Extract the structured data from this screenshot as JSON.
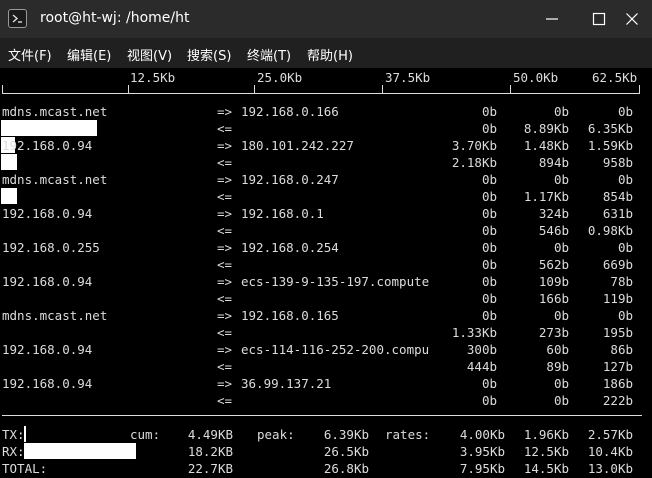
{
  "window": {
    "title": "root@ht-wj: /home/ht"
  },
  "menu": [
    "文件(F)",
    "编辑(E)",
    "视图(V)",
    "搜索(S)",
    "终端(T)",
    "帮助(H)"
  ],
  "scale": [
    "12.5Kb",
    "25.0Kb",
    "37.5Kb",
    "50.0Kb",
    "62.5Kb"
  ],
  "flows": [
    {
      "host": "mdns.mcast.net",
      "out": {
        "dir": "=>",
        "dest": "192.168.0.166",
        "v1": "0b",
        "v2": "0b",
        "v3": "0b"
      },
      "in": {
        "dir": "<=",
        "v1": "0b",
        "v2": "8.89Kb",
        "v3": "6.35Kb"
      }
    },
    {
      "host": "192.168.0.94",
      "out": {
        "dir": "=>",
        "dest": "180.101.242.227",
        "v1": "3.70Kb",
        "v2": "1.48Kb",
        "v3": "1.59Kb"
      },
      "in": {
        "dir": "<=",
        "v1": "2.18Kb",
        "v2": "894b",
        "v3": "958b"
      }
    },
    {
      "host": "mdns.mcast.net",
      "out": {
        "dir": "=>",
        "dest": "192.168.0.247",
        "v1": "0b",
        "v2": "0b",
        "v3": "0b"
      },
      "in": {
        "dir": "<=",
        "v1": "0b",
        "v2": "1.17Kb",
        "v3": "854b"
      }
    },
    {
      "host": "192.168.0.94",
      "out": {
        "dir": "=>",
        "dest": "192.168.0.1",
        "v1": "0b",
        "v2": "324b",
        "v3": "631b"
      },
      "in": {
        "dir": "<=",
        "v1": "0b",
        "v2": "546b",
        "v3": "0.98Kb"
      }
    },
    {
      "host": "192.168.0.255",
      "out": {
        "dir": "=>",
        "dest": "192.168.0.254",
        "v1": "0b",
        "v2": "0b",
        "v3": "0b"
      },
      "in": {
        "dir": "<=",
        "v1": "0b",
        "v2": "562b",
        "v3": "669b"
      }
    },
    {
      "host": "192.168.0.94",
      "out": {
        "dir": "=>",
        "dest": "ecs-139-9-135-197.compute",
        "v1": "0b",
        "v2": "109b",
        "v3": "78b"
      },
      "in": {
        "dir": "<=",
        "v1": "0b",
        "v2": "166b",
        "v3": "119b"
      }
    },
    {
      "host": "mdns.mcast.net",
      "out": {
        "dir": "=>",
        "dest": "192.168.0.165",
        "v1": "0b",
        "v2": "0b",
        "v3": "0b"
      },
      "in": {
        "dir": "<=",
        "v1": "1.33Kb",
        "v2": "273b",
        "v3": "195b"
      }
    },
    {
      "host": "192.168.0.94",
      "out": {
        "dir": "=>",
        "dest": "ecs-114-116-252-200.compu",
        "v1": "300b",
        "v2": "60b",
        "v3": "86b"
      },
      "in": {
        "dir": "<=",
        "v1": "444b",
        "v2": "89b",
        "v3": "127b"
      }
    },
    {
      "host": "192.168.0.94",
      "out": {
        "dir": "=>",
        "dest": "36.99.137.21",
        "v1": "0b",
        "v2": "0b",
        "v3": "186b"
      },
      "in": {
        "dir": "<=",
        "v1": "0b",
        "v2": "0b",
        "v3": "222b"
      }
    }
  ],
  "totals": {
    "labels": {
      "cum": "cum:",
      "peak": "peak:",
      "rates": "rates:"
    },
    "rows": [
      {
        "name": "TX:",
        "cum": "4.49KB",
        "peak": "6.39Kb",
        "r1": "4.00Kb",
        "r2": "1.96Kb",
        "r3": "2.57Kb"
      },
      {
        "name": "RX:",
        "cum": "18.2KB",
        "peak": "26.5Kb",
        "r1": "3.95Kb",
        "r2": "12.5Kb",
        "r3": "10.4Kb"
      },
      {
        "name": "TOTAL:",
        "cum": "22.7KB",
        "peak": "26.8Kb",
        "r1": "7.95Kb",
        "r2": "14.5Kb",
        "r3": "13.0Kb"
      }
    ]
  }
}
